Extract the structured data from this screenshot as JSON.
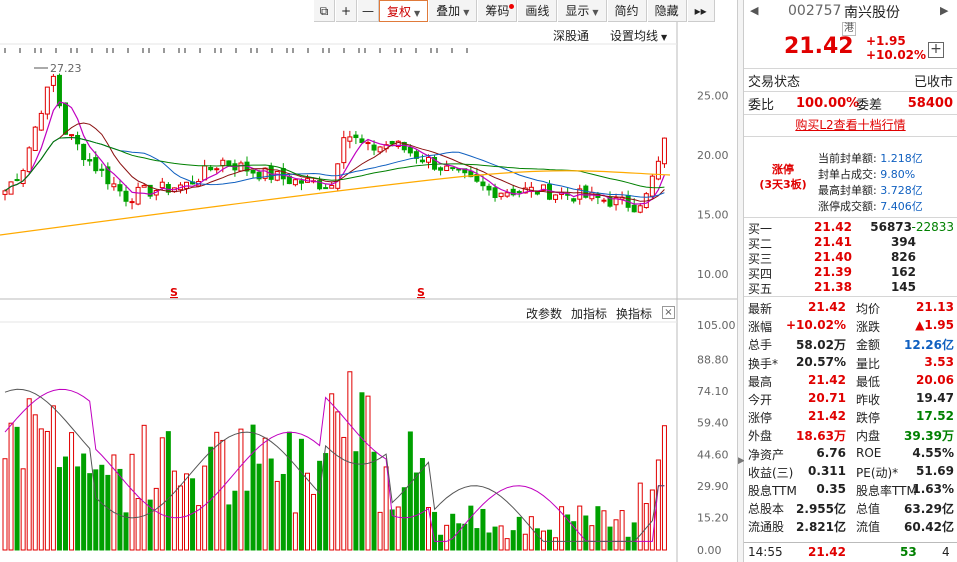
{
  "toolbar": {
    "buttons": [
      {
        "label": "",
        "name": "layout-toggle-button"
      },
      {
        "label": "+",
        "name": "zoom-in-button"
      },
      {
        "label": "—",
        "name": "zoom-out-button"
      },
      {
        "label": "复权",
        "name": "adjust-button",
        "active": true,
        "caret": true
      },
      {
        "label": "叠加",
        "name": "overlay-button",
        "caret": true
      },
      {
        "label": "筹码",
        "name": "chips-button",
        "dot": true
      },
      {
        "label": "画线",
        "name": "draw-line-button"
      },
      {
        "label": "显示",
        "name": "display-button",
        "caret": true
      },
      {
        "label": "简约",
        "name": "simple-button"
      },
      {
        "label": "隐藏",
        "name": "hide-button"
      },
      {
        "label": "▸▸",
        "name": "expand-button"
      }
    ]
  },
  "kline": {
    "header_links": [
      "深股通",
      "设置均线"
    ],
    "max_annotation": "27.23",
    "price_ticks": [
      "25.00",
      "20.00",
      "15.00",
      "10.00"
    ],
    "event_markers": [
      "S",
      "S"
    ],
    "colors": {
      "up": "#e00000",
      "down": "#00a000",
      "ma5": "#c000c0",
      "ma10": "#8a1010",
      "ma20": "#1060c0",
      "ma60": "#008000",
      "ma120": "#ffaa00"
    }
  },
  "volume": {
    "header_links": [
      "改参数",
      "加指标",
      "换指标"
    ],
    "close_label": "×",
    "ticks": [
      "105.00",
      "88.80",
      "74.10",
      "59.40",
      "44.60",
      "29.90",
      "15.20",
      "0.00"
    ]
  },
  "quote": {
    "code": "002757",
    "name": "南兴股份",
    "tag": "港",
    "price": "21.42",
    "change": "+1.95",
    "change_pct": "+10.02%",
    "status_label": "交易状态",
    "status_value": "已收市",
    "ratio_label": "委比",
    "ratio_value": "100.00%",
    "diff_label": "委差",
    "diff_value": "58400",
    "l2_link": "购买L2查看十档行情",
    "limit_label": "涨停",
    "limit_sub": "(3天3板)",
    "seal": [
      {
        "label": "当前封单额:",
        "value": "1.218亿"
      },
      {
        "label": "封单占成交:",
        "value": "9.80%"
      },
      {
        "label": "最高封单额:",
        "value": "3.728亿"
      },
      {
        "label": "涨停成交额:",
        "value": "7.406亿"
      }
    ],
    "bids": [
      {
        "label": "买一",
        "price": "21.42",
        "vol": "56873",
        "extra": "-22833"
      },
      {
        "label": "买二",
        "price": "21.41",
        "vol": "394",
        "extra": ""
      },
      {
        "label": "买三",
        "price": "21.40",
        "vol": "826",
        "extra": ""
      },
      {
        "label": "买四",
        "price": "21.39",
        "vol": "162",
        "extra": ""
      },
      {
        "label": "买五",
        "price": "21.38",
        "vol": "145",
        "extra": ""
      }
    ],
    "stats": [
      {
        "l1": "最新",
        "v1": "21.42",
        "c1": "red",
        "l2": "均价",
        "v2": "21.13",
        "c2": "red"
      },
      {
        "l1": "涨幅",
        "v1": "+10.02%",
        "c1": "red",
        "l2": "涨跌",
        "v2": "▲1.95",
        "c2": "red"
      },
      {
        "l1": "总手",
        "v1": "58.02万",
        "c1": "",
        "l2": "金额",
        "v2": "12.26亿",
        "c2": "blue"
      },
      {
        "l1": "换手*",
        "v1": "20.57%",
        "c1": "",
        "l2": "量比",
        "v2": "3.53",
        "c2": "red"
      },
      {
        "l1": "最高",
        "v1": "21.42",
        "c1": "red",
        "l2": "最低",
        "v2": "20.06",
        "c2": "red"
      },
      {
        "l1": "今开",
        "v1": "20.71",
        "c1": "red",
        "l2": "昨收",
        "v2": "19.47",
        "c2": ""
      },
      {
        "l1": "涨停",
        "v1": "21.42",
        "c1": "red",
        "l2": "跌停",
        "v2": "17.52",
        "c2": "green"
      },
      {
        "l1": "外盘",
        "v1": "18.63万",
        "c1": "red",
        "l2": "内盘",
        "v2": "39.39万",
        "c2": "green"
      },
      {
        "l1": "净资产",
        "v1": "6.76",
        "c1": "",
        "l2": "ROE",
        "v2": "4.55%",
        "c2": ""
      },
      {
        "l1": "收益(三)",
        "v1": "0.311",
        "c1": "",
        "l2": "PE(动)*",
        "v2": "51.69",
        "c2": ""
      },
      {
        "l1": "股息TTM",
        "v1": "0.35",
        "c1": "",
        "l2": "股息率TTM",
        "v2": "1.63%",
        "c2": ""
      },
      {
        "l1": "总股本",
        "v1": "2.955亿",
        "c1": "",
        "l2": "总值",
        "v2": "63.29亿",
        "c2": ""
      },
      {
        "l1": "流通股",
        "v1": "2.821亿",
        "c1": "",
        "l2": "流值",
        "v2": "60.42亿",
        "c2": ""
      }
    ],
    "tick": {
      "time": "14:55",
      "price": "21.42",
      "vol": "53",
      "count": "4"
    }
  }
}
